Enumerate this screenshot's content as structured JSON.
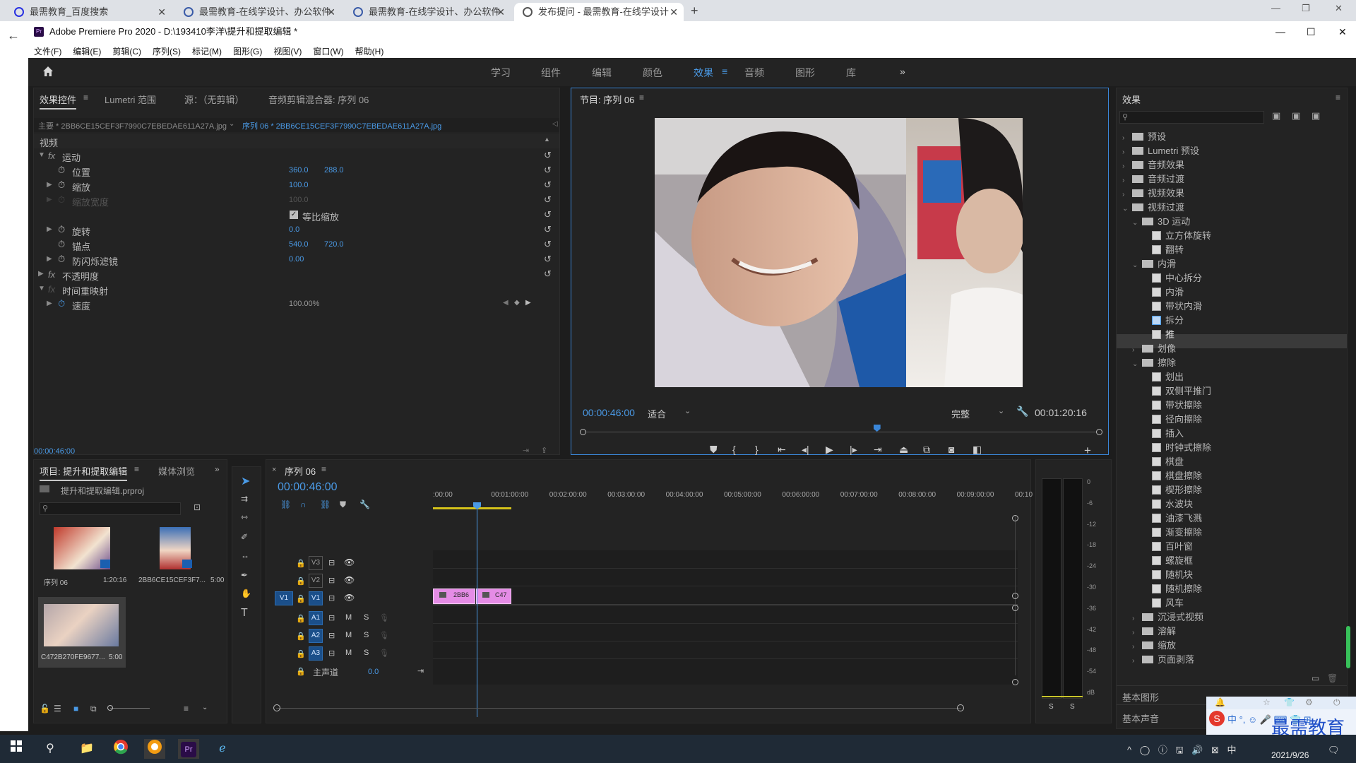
{
  "browser": {
    "tabs": [
      {
        "title": "最需教育_百度搜索"
      },
      {
        "title": "最需教育-在线学设计、办公软件"
      },
      {
        "title": "最需教育-在线学设计、办公软件"
      },
      {
        "title": "发布提问 - 最需教育-在线学设计"
      }
    ],
    "new_tab": "+",
    "min": "—",
    "max": "❐",
    "close": "✕"
  },
  "app": {
    "title": "Adobe Premiere Pro 2020 - D:\\193410李洋\\提升和提取编辑 *",
    "logo": "Pr",
    "menu": [
      "文件(F)",
      "编辑(E)",
      "剪辑(C)",
      "序列(S)",
      "标记(M)",
      "图形(G)",
      "视图(V)",
      "窗口(W)",
      "帮助(H)"
    ],
    "win_min": "—",
    "win_max": "☐",
    "win_close": "✕"
  },
  "workspaces": {
    "items": [
      "学习",
      "组件",
      "编辑",
      "颜色",
      "效果",
      "音频",
      "图形",
      "库"
    ],
    "active": "效果",
    "more": "»"
  },
  "effect_controls": {
    "tabs": [
      "效果控件",
      "Lumetri 范围",
      "源：（无剪辑）",
      "音频剪辑混合器: 序列 06"
    ],
    "master": "主要 * 2BB6CE15CEF3F7990C7EBEDAE611A27A.jpg",
    "sequence_clip": "序列 06 * 2BB6CE15CEF3F7990C7EBEDAE611A27A.jpg",
    "video_header": "视频",
    "motion": "运动",
    "position_label": "位置",
    "position_x": "360.0",
    "position_y": "288.0",
    "scale_label": "缩放",
    "scale_value": "100.0",
    "scale_width_label": "缩放宽度",
    "scale_width_value": "100.0",
    "uniform_scale_label": "等比缩放",
    "rotation_label": "旋转",
    "rotation_value": "0.0",
    "anchor_label": "锚点",
    "anchor_x": "540.0",
    "anchor_y": "720.0",
    "antiflicker_label": "防闪烁滤镜",
    "antiflicker_value": "0.00",
    "opacity_label": "不透明度",
    "time_remap_label": "时间重映射",
    "speed_label": "速度",
    "speed_value": "100.00%",
    "timecode": "00:00:46:00"
  },
  "program_monitor": {
    "title": "节目: 序列 06",
    "timecode": "00:00:46:00",
    "fit": "适合",
    "quality": "完整",
    "duration": "00:01:20:16",
    "playhead_fraction": 0.57
  },
  "effects_panel": {
    "title": "效果",
    "items": [
      {
        "type": "folder",
        "depth": 0,
        "label": "预设",
        "open": false
      },
      {
        "type": "folder",
        "depth": 0,
        "label": "Lumetri 预设",
        "open": false
      },
      {
        "type": "folder",
        "depth": 0,
        "label": "音频效果",
        "open": false
      },
      {
        "type": "folder",
        "depth": 0,
        "label": "音频过渡",
        "open": false
      },
      {
        "type": "folder",
        "depth": 0,
        "label": "视频效果",
        "open": false
      },
      {
        "type": "folder",
        "depth": 0,
        "label": "视频过渡",
        "open": true
      },
      {
        "type": "folder",
        "depth": 1,
        "label": "3D 运动",
        "open": true
      },
      {
        "type": "fx",
        "depth": 2,
        "label": "立方体旋转"
      },
      {
        "type": "fx",
        "depth": 2,
        "label": "翻转"
      },
      {
        "type": "folder",
        "depth": 1,
        "label": "内滑",
        "open": true
      },
      {
        "type": "fx",
        "depth": 2,
        "label": "中心拆分"
      },
      {
        "type": "fx",
        "depth": 2,
        "label": "内滑"
      },
      {
        "type": "fx",
        "depth": 2,
        "label": "带状内滑"
      },
      {
        "type": "fx",
        "depth": 2,
        "label": "拆分",
        "selected_icon": true
      },
      {
        "type": "fx",
        "depth": 2,
        "label": "推",
        "highlight": true
      },
      {
        "type": "folder",
        "depth": 1,
        "label": "划像",
        "open": false
      },
      {
        "type": "folder",
        "depth": 1,
        "label": "擦除",
        "open": true
      },
      {
        "type": "fx",
        "depth": 2,
        "label": "划出"
      },
      {
        "type": "fx",
        "depth": 2,
        "label": "双侧平推门"
      },
      {
        "type": "fx",
        "depth": 2,
        "label": "带状擦除"
      },
      {
        "type": "fx",
        "depth": 2,
        "label": "径向擦除"
      },
      {
        "type": "fx",
        "depth": 2,
        "label": "插入"
      },
      {
        "type": "fx",
        "depth": 2,
        "label": "时钟式擦除"
      },
      {
        "type": "fx",
        "depth": 2,
        "label": "棋盘"
      },
      {
        "type": "fx",
        "depth": 2,
        "label": "棋盘擦除"
      },
      {
        "type": "fx",
        "depth": 2,
        "label": "楔形擦除"
      },
      {
        "type": "fx",
        "depth": 2,
        "label": "水波块"
      },
      {
        "type": "fx",
        "depth": 2,
        "label": "油漆飞溅"
      },
      {
        "type": "fx",
        "depth": 2,
        "label": "渐变擦除"
      },
      {
        "type": "fx",
        "depth": 2,
        "label": "百叶窗"
      },
      {
        "type": "fx",
        "depth": 2,
        "label": "螺旋框"
      },
      {
        "type": "fx",
        "depth": 2,
        "label": "随机块"
      },
      {
        "type": "fx",
        "depth": 2,
        "label": "随机擦除"
      },
      {
        "type": "fx",
        "depth": 2,
        "label": "风车"
      },
      {
        "type": "folder",
        "depth": 1,
        "label": "沉浸式视频",
        "open": false
      },
      {
        "type": "folder",
        "depth": 1,
        "label": "溶解",
        "open": false
      },
      {
        "type": "folder",
        "depth": 1,
        "label": "缩放",
        "open": false
      },
      {
        "type": "folder",
        "depth": 1,
        "label": "页面剥落",
        "open": false
      }
    ],
    "essential_graphics": "基本图形",
    "essential_sound": "基本声音"
  },
  "project_panel": {
    "tabs": [
      "项目: 提升和提取编辑",
      "媒体浏览"
    ],
    "file": "提升和提取编辑.prproj",
    "items": [
      {
        "name": "序列 06",
        "duration": "1:20:16"
      },
      {
        "name": "2BB6CE15CEF3F7...",
        "duration": "5:00"
      },
      {
        "name": "C472B270FE9677...",
        "duration": "5:00"
      }
    ]
  },
  "timeline": {
    "title": "序列 06",
    "timecode": "00:00:46:00",
    "ruler": [
      ":00:00",
      "00:01:00:00",
      "00:02:00:00",
      "00:03:00:00",
      "00:04:00:00",
      "00:05:00:00",
      "00:06:00:00",
      "00:07:00:00",
      "00:08:00:00",
      "00:09:00:00",
      "00:10"
    ],
    "video_tracks": [
      "V3",
      "V2",
      "V1"
    ],
    "audio_tracks": [
      "A1",
      "A2",
      "A3"
    ],
    "source_patch": "V1",
    "mute": "M",
    "solo": "S",
    "master": "主声道",
    "master_value": "0.0",
    "clips": [
      {
        "label": "2BB6"
      },
      {
        "label": "C47"
      }
    ]
  },
  "audio_meter": {
    "scale": [
      "0",
      "-6",
      "-12",
      "-18",
      "-24",
      "-30",
      "-36",
      "-42",
      "-48",
      "-54",
      "dB"
    ],
    "solo_labels": [
      "S",
      "S"
    ]
  },
  "ime": {
    "chars": "中 °, ☺ 🎤 ⌨ 👕 ⊞",
    "brand": "最需教育"
  },
  "taskbar": {
    "clock_date": "2021/9/26",
    "tray": "^ ◯ ⓘ 🖫 🔊 ⊠ 中"
  },
  "colors": {
    "accent": "#4a9ae6",
    "clip": "#e58ce6",
    "workarea": "#d4c21a"
  }
}
